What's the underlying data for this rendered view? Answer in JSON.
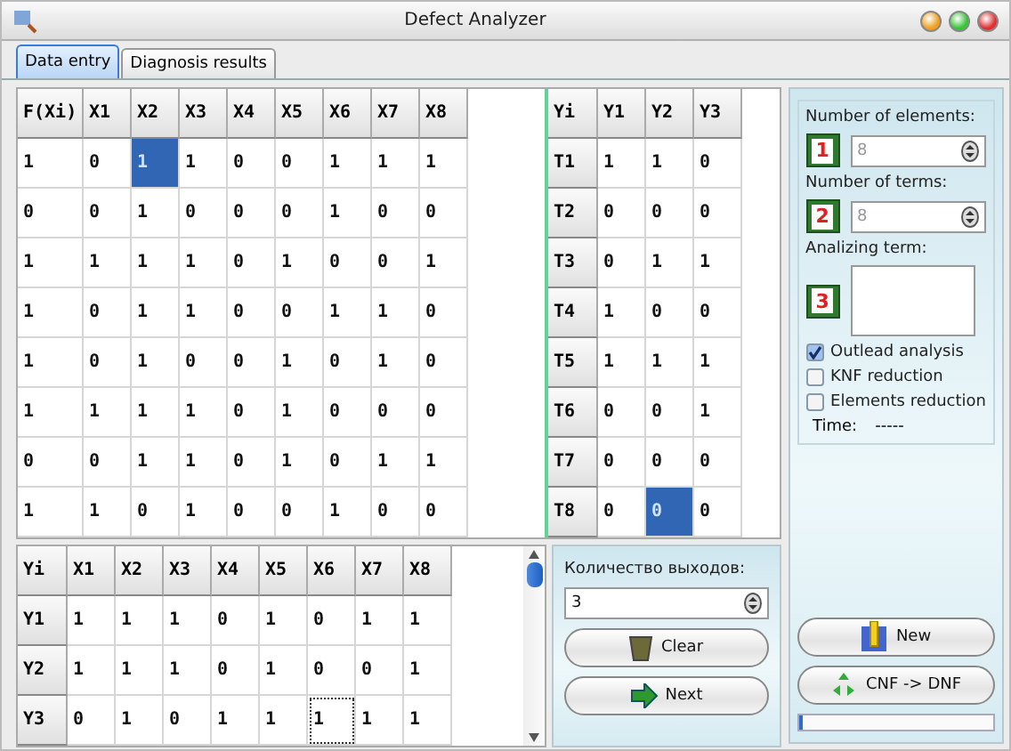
{
  "window": {
    "title": "Defect Analyzer"
  },
  "tabs": [
    {
      "label": "Data entry",
      "selected": true
    },
    {
      "label": "Diagnosis results",
      "selected": false
    }
  ],
  "function_table": {
    "columns": [
      "F(Xi)",
      "X1",
      "X2",
      "X3",
      "X4",
      "X5",
      "X6",
      "X7",
      "X8"
    ],
    "rows": [
      [
        {
          "text": "1",
          "selected": false
        },
        {
          "text": "0",
          "selected": false
        },
        {
          "text": "1",
          "selected": true
        },
        {
          "text": "1",
          "selected": false
        },
        {
          "text": "0",
          "selected": false
        },
        {
          "text": "0",
          "selected": false
        },
        {
          "text": "1",
          "selected": false
        },
        {
          "text": "1",
          "selected": false
        },
        {
          "text": "1",
          "selected": false
        }
      ],
      [
        {
          "text": "0",
          "selected": false
        },
        {
          "text": "0",
          "selected": false
        },
        {
          "text": "1",
          "selected": false
        },
        {
          "text": "0",
          "selected": false
        },
        {
          "text": "0",
          "selected": false
        },
        {
          "text": "0",
          "selected": false
        },
        {
          "text": "1",
          "selected": false
        },
        {
          "text": "0",
          "selected": false
        },
        {
          "text": "0",
          "selected": false
        }
      ],
      [
        {
          "text": "1",
          "selected": false
        },
        {
          "text": "1",
          "selected": false
        },
        {
          "text": "1",
          "selected": false
        },
        {
          "text": "1",
          "selected": false
        },
        {
          "text": "0",
          "selected": false
        },
        {
          "text": "1",
          "selected": false
        },
        {
          "text": "0",
          "selected": false
        },
        {
          "text": "0",
          "selected": false
        },
        {
          "text": "1",
          "selected": false
        }
      ],
      [
        {
          "text": "1",
          "selected": false
        },
        {
          "text": "0",
          "selected": false
        },
        {
          "text": "1",
          "selected": false
        },
        {
          "text": "1",
          "selected": false
        },
        {
          "text": "0",
          "selected": false
        },
        {
          "text": "0",
          "selected": false
        },
        {
          "text": "1",
          "selected": false
        },
        {
          "text": "1",
          "selected": false
        },
        {
          "text": "0",
          "selected": false
        }
      ],
      [
        {
          "text": "1",
          "selected": false
        },
        {
          "text": "0",
          "selected": false
        },
        {
          "text": "1",
          "selected": false
        },
        {
          "text": "0",
          "selected": false
        },
        {
          "text": "0",
          "selected": false
        },
        {
          "text": "1",
          "selected": false
        },
        {
          "text": "0",
          "selected": false
        },
        {
          "text": "1",
          "selected": false
        },
        {
          "text": "0",
          "selected": false
        }
      ],
      [
        {
          "text": "1",
          "selected": false
        },
        {
          "text": "1",
          "selected": false
        },
        {
          "text": "1",
          "selected": false
        },
        {
          "text": "1",
          "selected": false
        },
        {
          "text": "0",
          "selected": false
        },
        {
          "text": "1",
          "selected": false
        },
        {
          "text": "0",
          "selected": false
        },
        {
          "text": "0",
          "selected": false
        },
        {
          "text": "0",
          "selected": false
        }
      ],
      [
        {
          "text": "0",
          "selected": false
        },
        {
          "text": "0",
          "selected": false
        },
        {
          "text": "1",
          "selected": false
        },
        {
          "text": "1",
          "selected": false
        },
        {
          "text": "0",
          "selected": false
        },
        {
          "text": "1",
          "selected": false
        },
        {
          "text": "0",
          "selected": false
        },
        {
          "text": "1",
          "selected": false
        },
        {
          "text": "1",
          "selected": false
        }
      ],
      [
        {
          "text": "1",
          "selected": false
        },
        {
          "text": "1",
          "selected": false
        },
        {
          "text": "0",
          "selected": false
        },
        {
          "text": "1",
          "selected": false
        },
        {
          "text": "0",
          "selected": false
        },
        {
          "text": "0",
          "selected": false
        },
        {
          "text": "1",
          "selected": false
        },
        {
          "text": "0",
          "selected": false
        },
        {
          "text": "0",
          "selected": false
        }
      ]
    ]
  },
  "terms_table": {
    "row_header_title": "Yi",
    "columns": [
      "Y1",
      "Y2",
      "Y3"
    ],
    "rows": [
      {
        "header": "T1",
        "cells": [
          {
            "text": "1",
            "selected": false
          },
          {
            "text": "1",
            "selected": false
          },
          {
            "text": "0",
            "selected": false
          }
        ]
      },
      {
        "header": "T2",
        "cells": [
          {
            "text": "0",
            "selected": false
          },
          {
            "text": "0",
            "selected": false
          },
          {
            "text": "0",
            "selected": false
          }
        ]
      },
      {
        "header": "T3",
        "cells": [
          {
            "text": "0",
            "selected": false
          },
          {
            "text": "1",
            "selected": false
          },
          {
            "text": "1",
            "selected": false
          }
        ]
      },
      {
        "header": "T4",
        "cells": [
          {
            "text": "1",
            "selected": false
          },
          {
            "text": "0",
            "selected": false
          },
          {
            "text": "0",
            "selected": false
          }
        ]
      },
      {
        "header": "T5",
        "cells": [
          {
            "text": "1",
            "selected": false
          },
          {
            "text": "1",
            "selected": false
          },
          {
            "text": "1",
            "selected": false
          }
        ]
      },
      {
        "header": "T6",
        "cells": [
          {
            "text": "0",
            "selected": false
          },
          {
            "text": "0",
            "selected": false
          },
          {
            "text": "1",
            "selected": false
          }
        ]
      },
      {
        "header": "T7",
        "cells": [
          {
            "text": "0",
            "selected": false
          },
          {
            "text": "0",
            "selected": false
          },
          {
            "text": "0",
            "selected": false
          }
        ]
      },
      {
        "header": "T8",
        "cells": [
          {
            "text": "0",
            "selected": false
          },
          {
            "text": "0",
            "selected": true
          },
          {
            "text": "0",
            "selected": false
          }
        ]
      }
    ]
  },
  "outputs_table": {
    "row_header_title": "Yi",
    "columns": [
      "X1",
      "X2",
      "X3",
      "X4",
      "X5",
      "X6",
      "X7",
      "X8"
    ],
    "rows": [
      {
        "header": "Y1",
        "cells": [
          {
            "text": "1",
            "focused": false
          },
          {
            "text": "1",
            "focused": false
          },
          {
            "text": "1",
            "focused": false
          },
          {
            "text": "0",
            "focused": false
          },
          {
            "text": "1",
            "focused": false
          },
          {
            "text": "0",
            "focused": false
          },
          {
            "text": "1",
            "focused": false
          },
          {
            "text": "1",
            "focused": false
          }
        ]
      },
      {
        "header": "Y2",
        "cells": [
          {
            "text": "1",
            "focused": false
          },
          {
            "text": "1",
            "focused": false
          },
          {
            "text": "1",
            "focused": false
          },
          {
            "text": "0",
            "focused": false
          },
          {
            "text": "1",
            "focused": false
          },
          {
            "text": "0",
            "focused": false
          },
          {
            "text": "0",
            "focused": false
          },
          {
            "text": "1",
            "focused": false
          }
        ]
      },
      {
        "header": "Y3",
        "cells": [
          {
            "text": "0",
            "focused": false
          },
          {
            "text": "1",
            "focused": false
          },
          {
            "text": "0",
            "focused": false
          },
          {
            "text": "1",
            "focused": false
          },
          {
            "text": "1",
            "focused": false
          },
          {
            "text": "1",
            "focused": true
          },
          {
            "text": "1",
            "focused": false
          },
          {
            "text": "1",
            "focused": false
          }
        ]
      }
    ]
  },
  "outputs_panel": {
    "label": "Количество выходов:",
    "value": "3",
    "buttons": [
      {
        "kind": "clear",
        "label": "Clear"
      },
      {
        "kind": "next",
        "label": "Next"
      }
    ]
  },
  "settings": {
    "fields": [
      {
        "label": "Number of elements:",
        "step": "1",
        "kind": "spin",
        "value": "8",
        "disabled": true
      },
      {
        "label": "Number of terms:",
        "step": "2",
        "kind": "spin",
        "value": "8",
        "disabled": true
      },
      {
        "label": "Analizing term:",
        "step": "3",
        "kind": "area",
        "disabled": false
      }
    ],
    "options": [
      {
        "label": "Outlead analysis",
        "checked": true
      },
      {
        "label": "KNF reduction",
        "checked": false
      },
      {
        "label": "Elements reduction",
        "checked": false
      }
    ],
    "time_label": "Time:",
    "time_value": "-----",
    "buttons": [
      {
        "kind": "new",
        "label": "New"
      },
      {
        "kind": "convert",
        "label": "CNF -> DNF"
      }
    ],
    "progress": {
      "level": 0.01
    }
  }
}
